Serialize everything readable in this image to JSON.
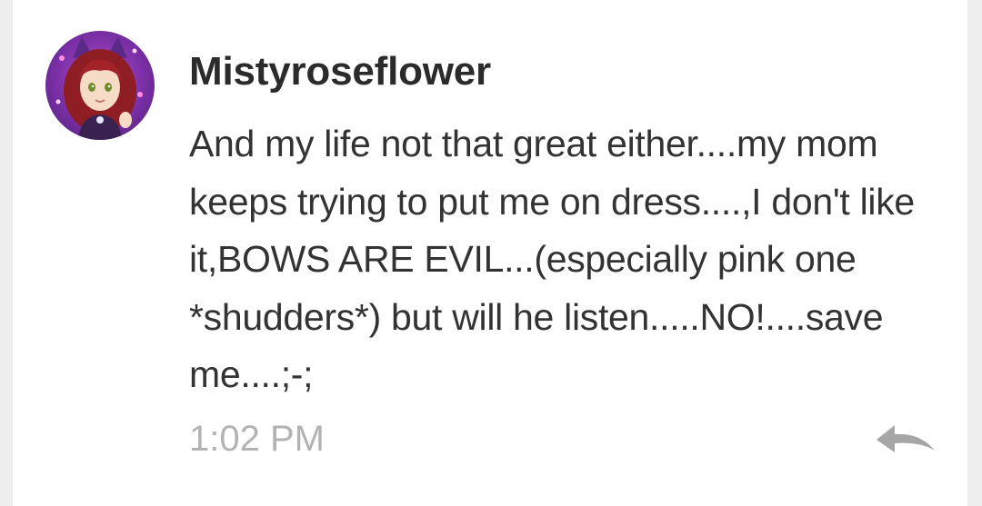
{
  "comment": {
    "username": "Mistyroseflower",
    "message": "And my life not that great either....my mom keeps trying to put me on dress....,I don't like it,BOWS ARE EVIL...(especially pink one *shudders*) but will he listen.....NO!....save me....;-;",
    "timestamp": "1:02 PM",
    "avatar_icon": "user-avatar",
    "reply_icon": "reply-arrow-icon"
  },
  "colors": {
    "background": "#eeeeee",
    "card": "#ffffff",
    "username": "#2b2b2b",
    "message": "#333333",
    "timestamp": "#b3b3b3",
    "reply_icon": "#a6a6a6"
  }
}
